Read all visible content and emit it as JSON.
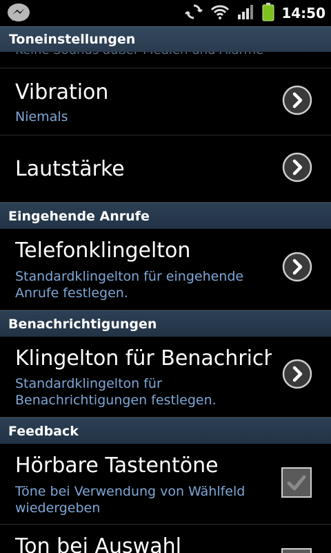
{
  "status_bar": {
    "time": "14:50",
    "icons": [
      "messenger-icon",
      "sync-icon",
      "wifi-icon",
      "signal-icon",
      "battery-icon"
    ]
  },
  "title": "Toneinstellungen",
  "cut_off_text": "Keine Sounds außer Medien und Alarme",
  "rows": {
    "vibration": {
      "title": "Vibration",
      "summary": "Niemals"
    },
    "lautstaerke": {
      "title": "Lautstärke"
    },
    "ringtone": {
      "title": "Telefonklingelton",
      "summary": "Standardklingelton für eingehende Anrufe festlegen."
    },
    "notification": {
      "title": "Klingelton für Benachrichtigungen",
      "summary": "Standardklingelton für Benachrichtigungen festlegen."
    },
    "touch_tones": {
      "title": "Hörbare Tastentöne",
      "summary": "Töne bei Verwendung von Wählfeld wiedergeben",
      "checked": true
    },
    "selection": {
      "title": "Ton bei Auswahl"
    }
  },
  "sections": {
    "incoming": "Eingehende Anrufe",
    "notifications": "Benachrichtigungen",
    "feedback": "Feedback"
  },
  "colors": {
    "summary": "#7ea7d6",
    "header": "#2c3f54"
  }
}
